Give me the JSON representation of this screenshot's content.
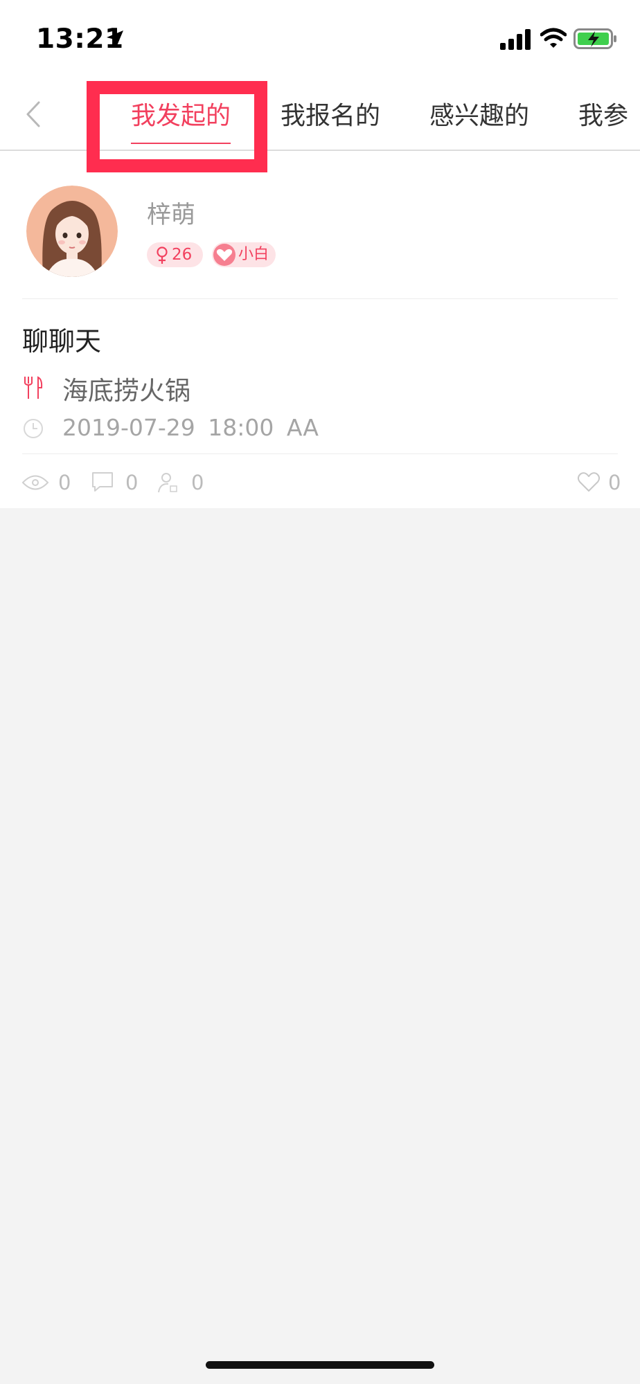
{
  "status_bar": {
    "time": "13:21",
    "icons": [
      "location-arrow-icon",
      "signal-icon",
      "wifi-icon",
      "battery-charging-icon"
    ]
  },
  "nav": {
    "back_icon": "chevron-left-icon",
    "tabs": [
      {
        "label": "我发起的",
        "active": true
      },
      {
        "label": "我报名的",
        "active": false
      },
      {
        "label": "感兴趣的",
        "active": false
      },
      {
        "label": "我参",
        "active": false
      }
    ]
  },
  "profile": {
    "name": "梓萌",
    "age": "26",
    "gender_icon": "female-icon",
    "level": "小白",
    "level_icon": "heart-badge-icon"
  },
  "event": {
    "title": "聊聊天",
    "place": "海底捞火锅",
    "place_icon": "fork-knife-icon",
    "datetime": "2019-07-29  18:00  AA",
    "time_icon": "clock-icon"
  },
  "stats": {
    "views": "0",
    "comments": "0",
    "signups": "0",
    "likes": "0"
  },
  "colors": {
    "accent": "#f2405e",
    "highlight_box": "#ff2d4f",
    "background": "#f3f3f3"
  }
}
